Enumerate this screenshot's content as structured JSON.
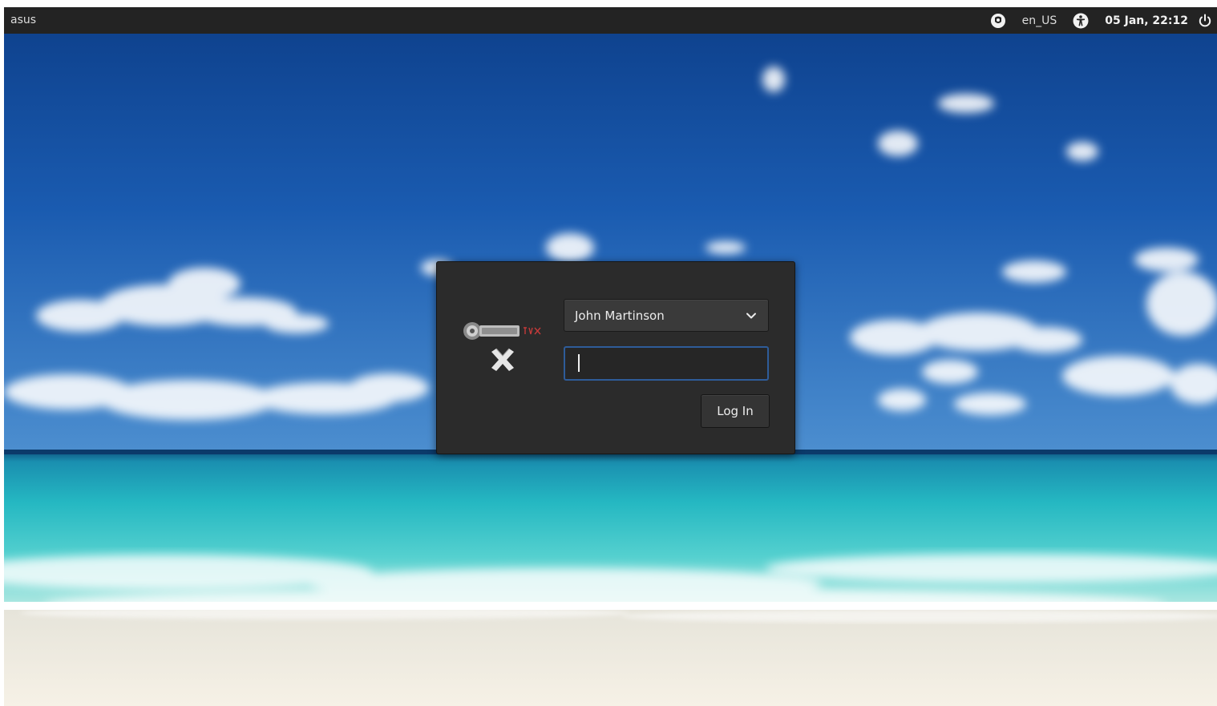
{
  "panel": {
    "hostname": "asus",
    "keyboard_layout": "en_US",
    "datetime": "05 Jan, 22:12",
    "icons": [
      "onboard-keyboard-icon",
      "accessibility-icon",
      "power-icon"
    ]
  },
  "login": {
    "selected_user": "John Martinson",
    "password_value": "",
    "login_button_label": "Log In",
    "logo": "distro-logo"
  },
  "colors": {
    "panel_bg": "#232323",
    "dialog_bg": "#2b2b2b",
    "focus_border": "#2e5c99",
    "sky": "#1e5aa8",
    "sea": "#2ab7c4",
    "sand": "#f2ede3"
  }
}
